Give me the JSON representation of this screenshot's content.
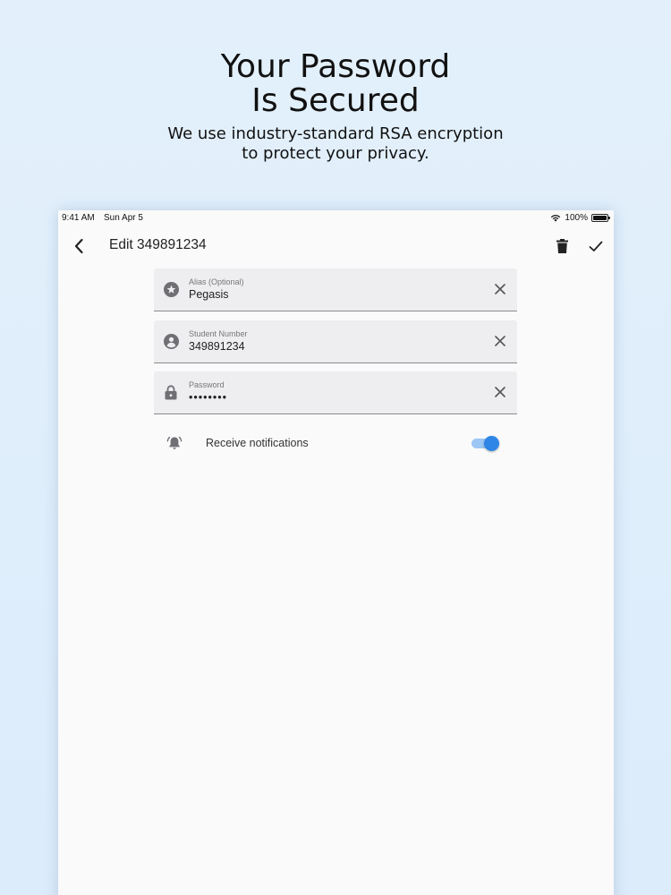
{
  "promo": {
    "title_line1": "Your Password",
    "title_line2": "Is Secured",
    "subtitle_line1": "We use industry-standard RSA encryption",
    "subtitle_line2": "to protect your privacy."
  },
  "status_bar": {
    "time": "9:41 AM",
    "date": "Sun Apr 5",
    "battery": "100%"
  },
  "appbar": {
    "title": "Edit 349891234",
    "icons": [
      "chevron-left-icon",
      "trash-icon",
      "check-icon"
    ]
  },
  "fields": {
    "alias": {
      "label": "Alias (Optional)",
      "value": "Pegasis",
      "icon": "star-circle-icon"
    },
    "student_number": {
      "label": "Student Number",
      "value": "349891234",
      "icon": "account-circle-icon"
    },
    "password": {
      "label": "Password",
      "value": "••••••••",
      "icon": "lock-icon"
    }
  },
  "notifications": {
    "label": "Receive notifications",
    "enabled": true,
    "icon": "bell-ringing-icon"
  },
  "colors": {
    "accent": "#2f86e6",
    "accent_track": "#9cc6f3",
    "field_bg": "#eeeef1",
    "page_bg": "#e3f0fb"
  }
}
